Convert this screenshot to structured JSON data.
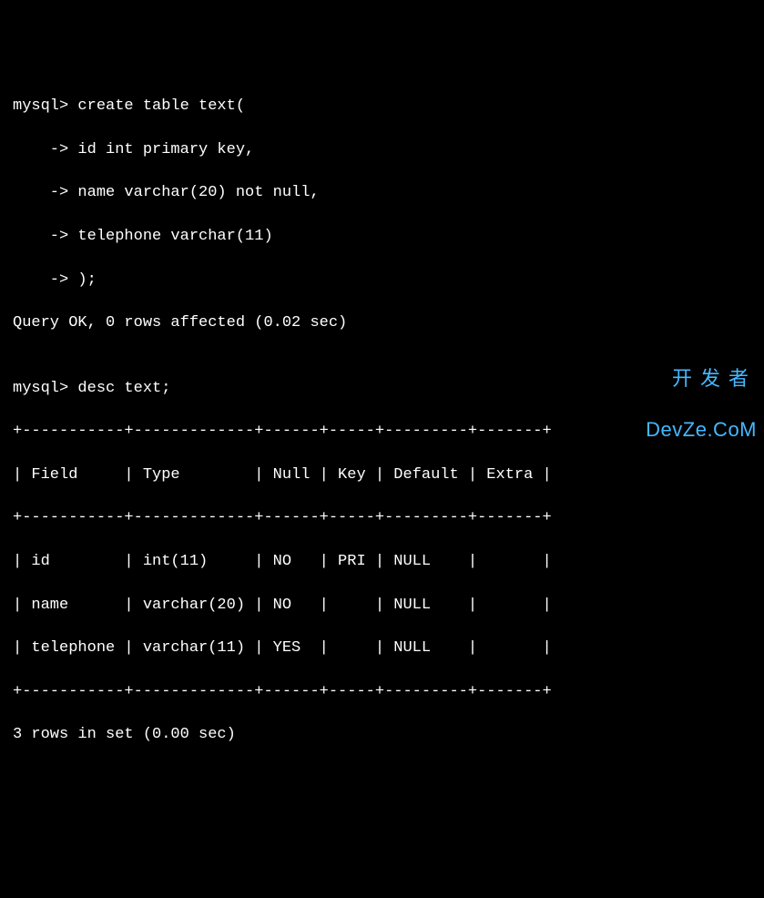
{
  "terminal": {
    "prompt": "mysql>",
    "continuation": "    ->",
    "lines": {
      "l1": "mysql> create table text(",
      "l2": "    -> id int primary key,",
      "l3": "    -> name varchar(20) not null,",
      "l4": "    -> telephone varchar(11)",
      "l5": "    -> );",
      "l6": "Query OK, 0 rows affected (0.02 sec)",
      "l7": "",
      "l8": "mysql> desc text;",
      "border": "+-----------+-------------+------+-----+---------+-------+",
      "header": "| Field     | Type        | Null | Key | Default | Extra |",
      "row1": "| id        | int(11)     | NO   | PRI | NULL    |       |",
      "row2": "| name      | varchar(20) | NO   |     | NULL    |       |",
      "row3": "| telephone | varchar(11) | YES  |     | NULL    |       |",
      "footer": "3 rows in set (0.00 sec)"
    }
  },
  "chart_data": {
    "type": "table",
    "title": "desc text",
    "columns": [
      "Field",
      "Type",
      "Null",
      "Key",
      "Default",
      "Extra"
    ],
    "rows": [
      {
        "Field": "id",
        "Type": "int(11)",
        "Null": "NO",
        "Key": "PRI",
        "Default": "NULL",
        "Extra": ""
      },
      {
        "Field": "name",
        "Type": "varchar(20)",
        "Null": "NO",
        "Key": "",
        "Default": "NULL",
        "Extra": ""
      },
      {
        "Field": "telephone",
        "Type": "varchar(11)",
        "Null": "YES",
        "Key": "",
        "Default": "NULL",
        "Extra": ""
      }
    ],
    "query_result_meta": {
      "create_status": "Query OK, 0 rows affected (0.02 sec)",
      "desc_status": "3 rows in set (0.00 sec)"
    }
  },
  "watermark": {
    "top": "开发者",
    "bottom": "DevZe.CoM"
  }
}
